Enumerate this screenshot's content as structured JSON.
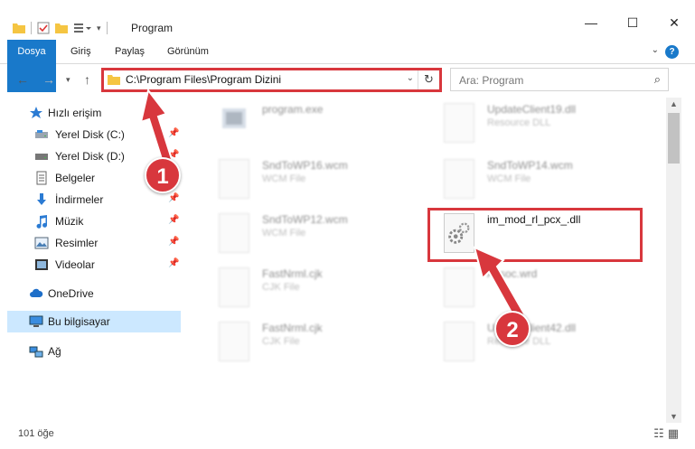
{
  "window": {
    "title": "Program",
    "controls": {
      "minimize": "—",
      "maximize": "☐",
      "close": "✕"
    }
  },
  "ribbon": {
    "tabs": [
      "Dosya",
      "Giriş",
      "Paylaş",
      "Görünüm"
    ],
    "help": "?",
    "accent": "#1979ca"
  },
  "address": {
    "path": "C:\\Program Files\\Program Dizini"
  },
  "search": {
    "placeholder": "Ara: Program"
  },
  "nav": {
    "quick_access": "Hızlı erişim",
    "items": [
      {
        "label": "Yerel Disk (C:)",
        "icon": "drive-icon",
        "pinned": true
      },
      {
        "label": "Yerel Disk (D:)",
        "icon": "drive-icon",
        "pinned": true
      },
      {
        "label": "Belgeler",
        "icon": "documents-icon",
        "pinned": true
      },
      {
        "label": "İndirmeler",
        "icon": "downloads-icon",
        "pinned": true
      },
      {
        "label": "Müzik",
        "icon": "music-icon",
        "pinned": true
      },
      {
        "label": "Resimler",
        "icon": "pictures-icon",
        "pinned": true
      },
      {
        "label": "Videolar",
        "icon": "videos-icon",
        "pinned": true
      }
    ],
    "onedrive": "OneDrive",
    "this_pc": "Bu bilgisayar",
    "network": "Ağ"
  },
  "files": [
    {
      "name": "program.exe",
      "type": ""
    },
    {
      "name": "UpdateClient19.dll",
      "type": "Resource DLL"
    },
    {
      "name": "SndToWP16.wcm",
      "type": "WCM File"
    },
    {
      "name": "SndToWP14.wcm",
      "type": "WCM File"
    },
    {
      "name": "SndToWP12.wcm",
      "type": "WCM File"
    },
    {
      "name": "im_mod_rl_pcx_.dll",
      "type": ""
    },
    {
      "name": "FastNrml.cjk",
      "type": "CJK File"
    },
    {
      "name": "Assoc.wrd",
      "type": ""
    },
    {
      "name": "FastNrml.cjk",
      "type": "CJK File"
    },
    {
      "name": "UpdateClient42.dll",
      "type": "Resource DLL"
    }
  ],
  "status": {
    "count": "101 öğe"
  },
  "annotations": {
    "step1": "1",
    "step2": "2",
    "color": "#d8373d"
  }
}
